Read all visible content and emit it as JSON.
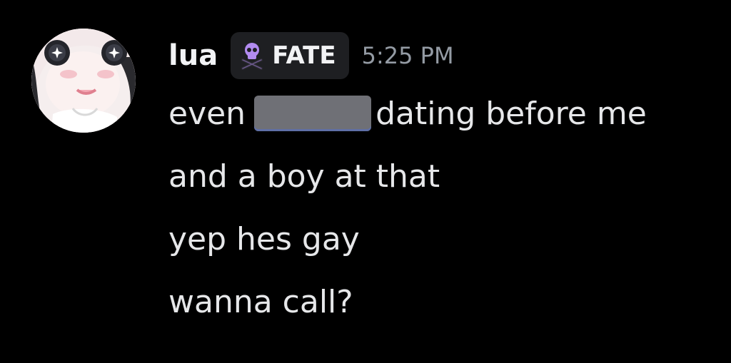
{
  "message": {
    "author": "lua",
    "tag": {
      "label": "FATE",
      "icon": "skull-crossbones-icon",
      "color": "#b28bf0"
    },
    "timestamp": "5:25 PM",
    "lines": [
      {
        "before_redaction": "even",
        "after_redaction": "dating before me"
      },
      {
        "text": "and a boy at that"
      },
      {
        "text": "yep hes gay"
      },
      {
        "text": "wanna call?"
      }
    ]
  },
  "colors": {
    "background": "#000000",
    "username": "#f2f3f5",
    "timestamp": "#949ba4",
    "message_text": "#e6e7e9",
    "tag_background": "#1e1f22",
    "redaction": "#6f7076"
  }
}
